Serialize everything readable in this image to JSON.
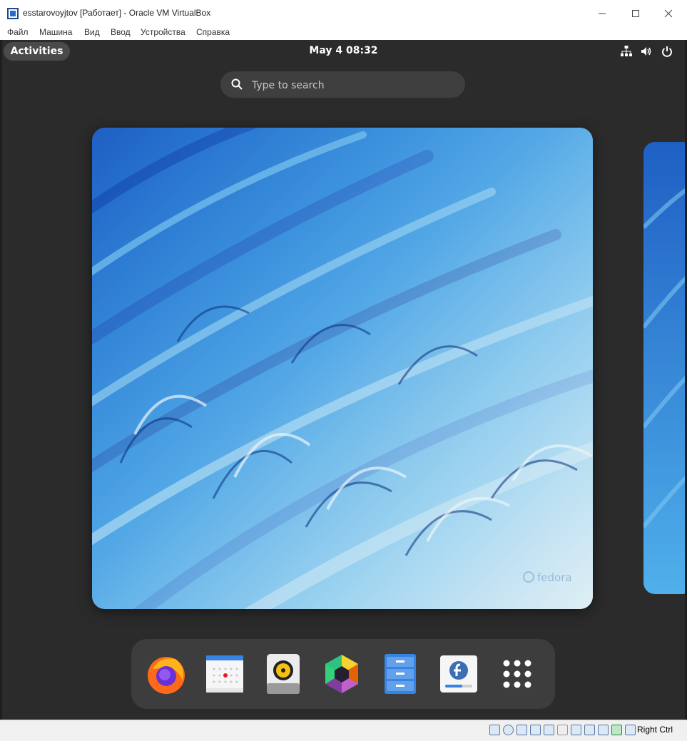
{
  "window": {
    "title": "esstarovoyjtov [Работает] - Oracle VM VirtualBox",
    "app_icon": "virtualbox-icon"
  },
  "menu": {
    "items": [
      "Файл",
      "Машина",
      "Вид",
      "Ввод",
      "Устройства",
      "Справка"
    ]
  },
  "topbar": {
    "activities_label": "Activities",
    "clock": "May 4  08:32",
    "tray_icons": [
      "network-wired-icon",
      "volume-icon",
      "power-icon"
    ]
  },
  "search": {
    "placeholder": "Type to search"
  },
  "workspace": {
    "wallpaper_watermark": "fedora"
  },
  "dash": {
    "apps": [
      "firefox-icon",
      "calendar-icon",
      "rhythmbox-icon",
      "software-icon",
      "files-icon",
      "fedora-installer-icon",
      "show-apps-icon"
    ]
  },
  "statusbar": {
    "host_key": "Right Ctrl"
  },
  "colors": {
    "shell_bg": "#2b2b2b",
    "accent_blue": "#3584e4"
  }
}
